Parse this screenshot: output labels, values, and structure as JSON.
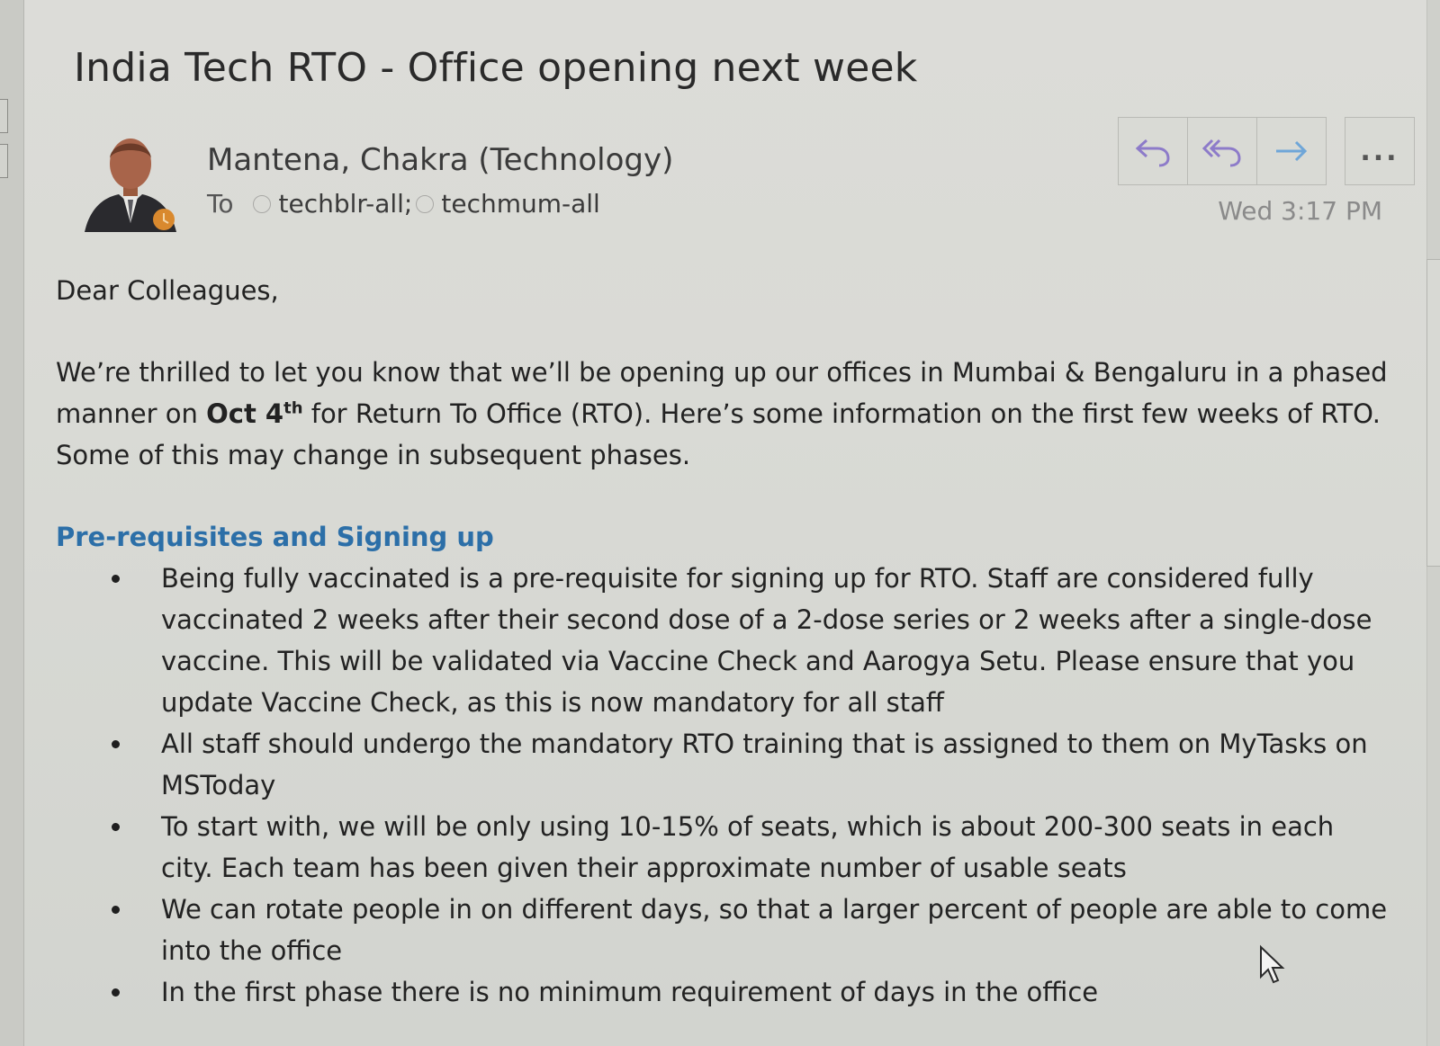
{
  "email": {
    "subject": "India Tech RTO - Office opening next week",
    "sender": "Mantena, Chakra (Technology)",
    "to_label": "To",
    "recipients": [
      "techblr-all;",
      "techmum-all"
    ],
    "timestamp": "Wed 3:17 PM"
  },
  "toolbar": {
    "reply_icon": "reply-icon",
    "reply_all_icon": "reply-all-icon",
    "forward_icon": "forward-icon",
    "more_label": "..."
  },
  "body": {
    "greeting": "Dear Colleagues,",
    "intro_part1": "We’re thrilled to let you know that we’ll be opening up our offices in Mumbai & Bengaluru in a phased manner on ",
    "intro_date": "Oct 4",
    "intro_date_sup": "th",
    "intro_part2": " for Return To Office (RTO). Here’s some information on the first few weeks of RTO. Some of this may change in subsequent phases.",
    "section_heading": "Pre-requisites and Signing up",
    "bullets": [
      "Being fully vaccinated is a pre-requisite for signing up for RTO. Staff are considered fully vaccinated 2 weeks after their second dose of a 2-dose series or 2 weeks after a single-dose vaccine. This will be validated via Vaccine Check and Aarogya Setu. Please ensure that you update Vaccine Check, as this is now mandatory for all staff",
      "All staff should undergo the mandatory RTO training that is assigned to them on MyTasks on MSToday",
      "To start with, we will be only using 10-15% of seats, which is about 200-300 seats in each city. Each team has been given their approximate number of usable seats",
      "We can rotate people in on different days, so that a larger percent of people are able to come into the office",
      "In the first phase there is no minimum requirement of days in the office"
    ]
  },
  "colors": {
    "heading_blue": "#2c6fa8",
    "toolbar_icon_purple": "#8d7bc9",
    "toolbar_icon_blue": "#6fa6d8"
  }
}
